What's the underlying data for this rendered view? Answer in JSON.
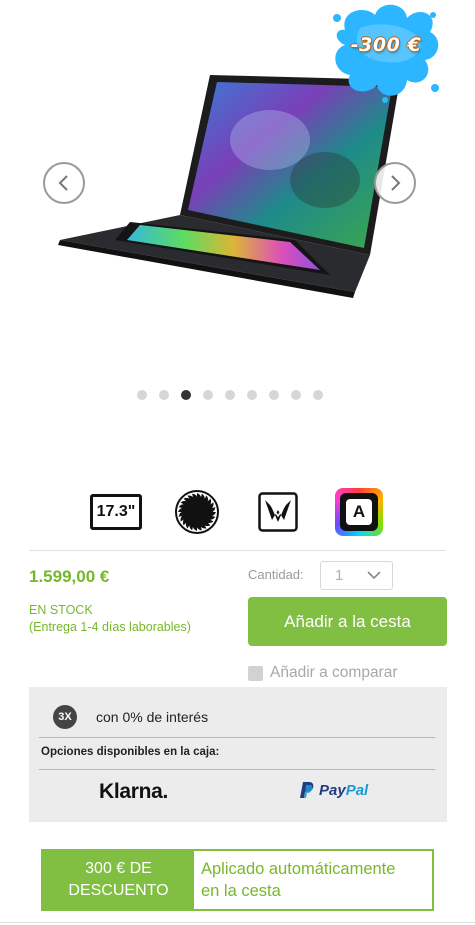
{
  "gallery": {
    "badge_text": "-300 €",
    "dot_count": 9,
    "active_dot_index": 2
  },
  "features": {
    "screen_size": "17.3\"",
    "keyboard_key": "A"
  },
  "product": {
    "price": "1.599,00 €",
    "quantity_label": "Cantidad:",
    "quantity_value": "1",
    "stock_status": "EN STOCK",
    "delivery": "(Entrega 1-4 días laborables)",
    "add_to_cart": "Añadir a la cesta",
    "compare": "Añadir a comparar"
  },
  "payment": {
    "installments_badge": "3X",
    "interest_text": "con 0% de interés",
    "options_label": "Opciones disponibles en la caja:",
    "klarna": "Klarna.",
    "paypal_pay": "Pay",
    "paypal_pal": "Pal"
  },
  "discount": {
    "line1": "300 € DE",
    "line2": "DESCUENTO",
    "applied_line1": "Aplicado automáticamente",
    "applied_line2": "en la cesta"
  },
  "colors": {
    "accent_green": "#80bf41",
    "text_green": "#76b82a",
    "badge_splash": "#29b6ff"
  }
}
